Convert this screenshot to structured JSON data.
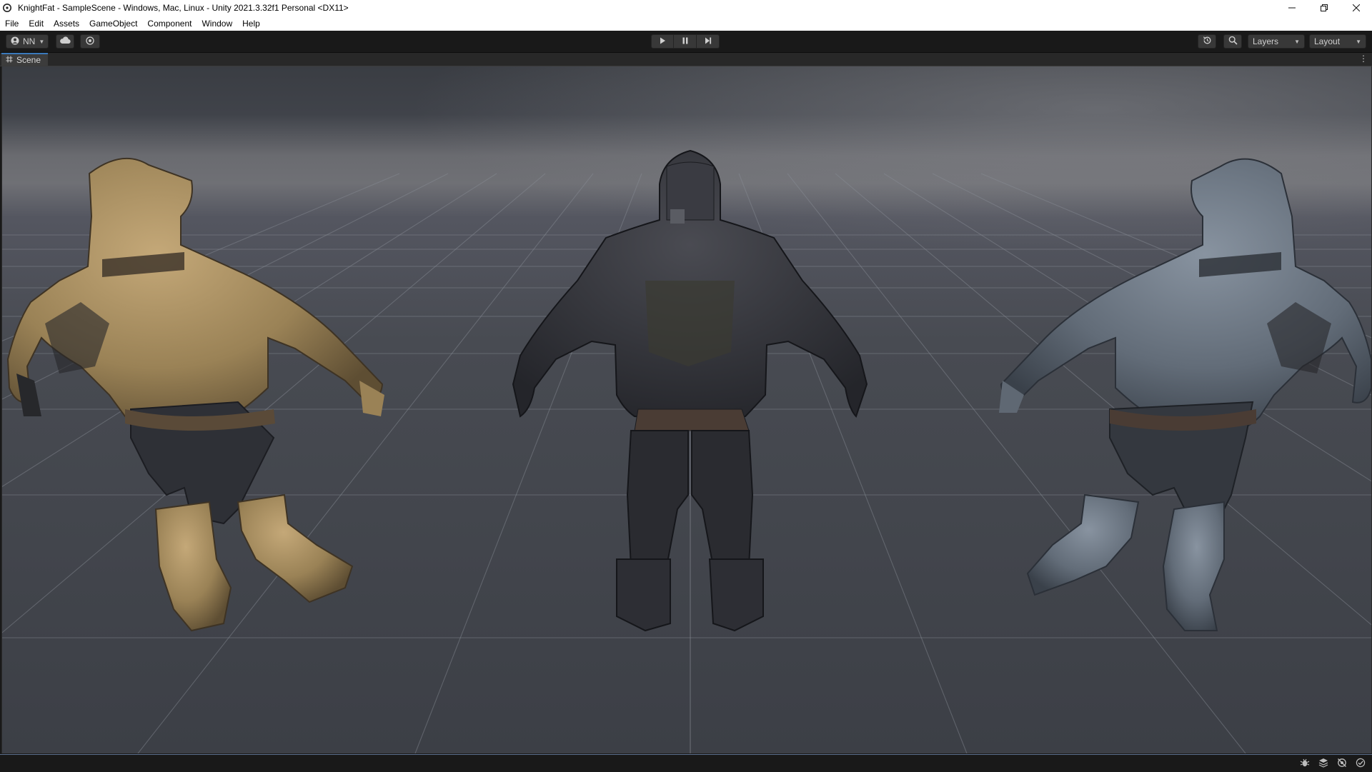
{
  "window": {
    "title": "KnightFat - SampleScene - Windows, Mac, Linux - Unity 2021.3.32f1 Personal <DX11>",
    "icon": "unity-logo-icon",
    "controls": [
      "minimize-icon",
      "restore-icon",
      "close-icon"
    ]
  },
  "menu": {
    "items": [
      "File",
      "Edit",
      "Assets",
      "GameObject",
      "Component",
      "Window",
      "Help"
    ]
  },
  "toolbar": {
    "account_label": "NN",
    "icons": [
      "account-icon",
      "cloud-icon",
      "collab-icon",
      "play-icon",
      "pause-icon",
      "step-icon",
      "history-icon",
      "search-icon"
    ],
    "layers_label": "Layers",
    "layout_label": "Layout"
  },
  "scene": {
    "tab_label": "Scene",
    "tab_icon": "hash-icon",
    "models": [
      {
        "name": "knight-gold",
        "color": "#a48c5f"
      },
      {
        "name": "knight-dark",
        "color": "#2f3036"
      },
      {
        "name": "knight-steel",
        "color": "#6c7682"
      }
    ]
  },
  "statusbar": {
    "icons": [
      "bug-icon",
      "layers-status-icon",
      "no-sync-icon",
      "check-icon"
    ]
  },
  "colors": {
    "accent": "#3a79bb",
    "viewport_bg": "#3e4147",
    "chrome_bg": "#191919"
  }
}
